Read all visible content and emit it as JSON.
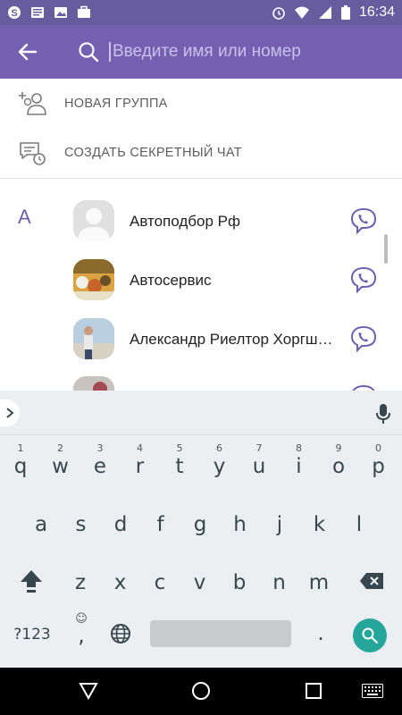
{
  "status_bar": {
    "time": "16:34",
    "icons_left": [
      "skype-icon",
      "news-icon",
      "gallery-icon",
      "briefcase-icon"
    ],
    "icons_right": [
      "alarm-icon",
      "wifi-icon",
      "signal-icon",
      "battery-icon"
    ]
  },
  "search": {
    "placeholder": "Введите имя или номер",
    "value": ""
  },
  "actions": [
    {
      "label": "НОВАЯ ГРУППА",
      "icon": "add-group-icon"
    },
    {
      "label": "СОЗДАТЬ СЕКРЕТНЫЙ ЧАТ",
      "icon": "secret-chat-icon"
    }
  ],
  "contacts": {
    "section_letter": "А",
    "items": [
      {
        "name": "Автоподбор Рф"
      },
      {
        "name": "Автосервис"
      },
      {
        "name": "Александр Риелтор Хоргш…"
      },
      {
        "name": ""
      }
    ]
  },
  "keyboard": {
    "row1": [
      {
        "key": "q",
        "hint": "1"
      },
      {
        "key": "w",
        "hint": "2"
      },
      {
        "key": "e",
        "hint": "3"
      },
      {
        "key": "r",
        "hint": "4"
      },
      {
        "key": "t",
        "hint": "5"
      },
      {
        "key": "y",
        "hint": "6"
      },
      {
        "key": "u",
        "hint": "7"
      },
      {
        "key": "i",
        "hint": "8"
      },
      {
        "key": "o",
        "hint": "9"
      },
      {
        "key": "p",
        "hint": "0"
      }
    ],
    "row2": [
      "a",
      "s",
      "d",
      "f",
      "g",
      "h",
      "j",
      "k",
      "l"
    ],
    "row3": [
      "z",
      "x",
      "c",
      "v",
      "b",
      "n",
      "m"
    ],
    "symbols_label": "?123",
    "comma": ",",
    "period": "."
  },
  "colors": {
    "app_bar": "#7360b0",
    "status_bar": "#665c9e",
    "accent": "#6f5fb0",
    "enter_key": "#26a69a"
  }
}
